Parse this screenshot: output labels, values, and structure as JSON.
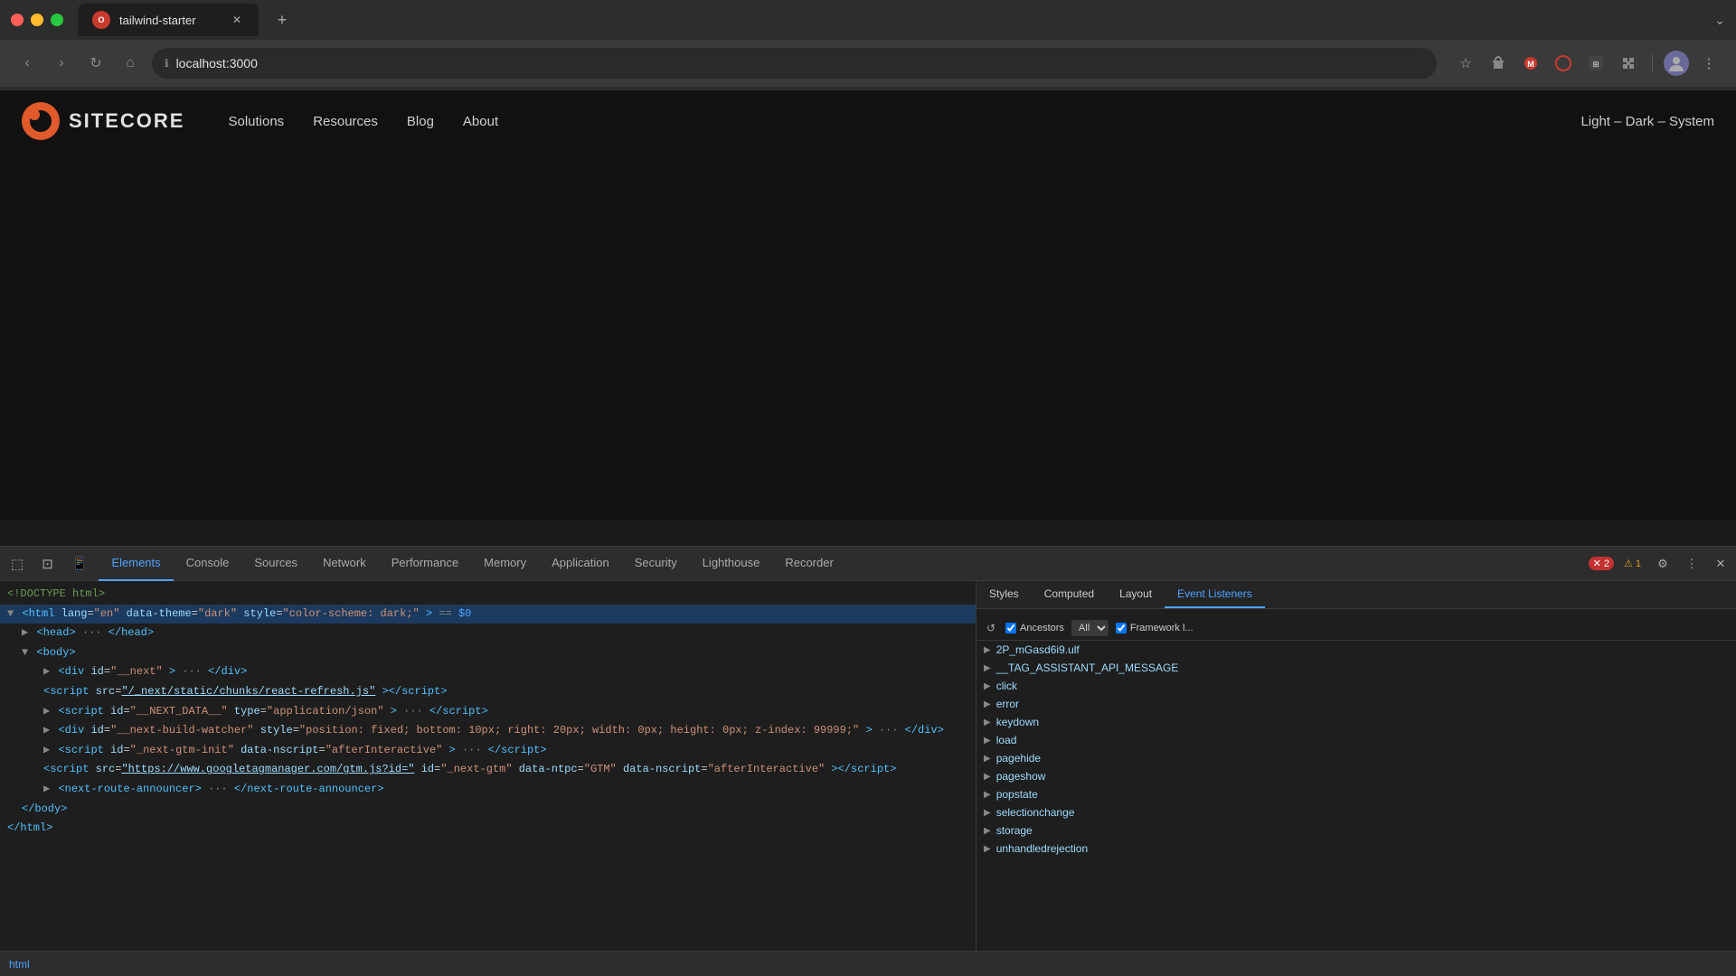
{
  "browser": {
    "tab_title": "tailwind-starter",
    "url": "localhost:3000",
    "new_tab_label": "+",
    "dropdown_label": "⌄"
  },
  "nav_buttons": {
    "back": "‹",
    "forward": "›",
    "reload": "↻",
    "home": "⌂"
  },
  "site": {
    "logo_text": "SITECORE",
    "nav_items": [
      "Solutions",
      "Resources",
      "Blog",
      "About"
    ],
    "theme_text": "Light – Dark – System"
  },
  "devtools": {
    "tabs": [
      {
        "label": "Elements",
        "active": true
      },
      {
        "label": "Console",
        "active": false
      },
      {
        "label": "Sources",
        "active": false
      },
      {
        "label": "Network",
        "active": false
      },
      {
        "label": "Performance",
        "active": false
      },
      {
        "label": "Memory",
        "active": false
      },
      {
        "label": "Application",
        "active": false
      },
      {
        "label": "Security",
        "active": false
      },
      {
        "label": "Lighthouse",
        "active": false
      },
      {
        "label": "Recorder",
        "active": false
      }
    ],
    "error_count": "2",
    "warn_count": "1",
    "dom": {
      "line1": "<!DOCTYPE html>",
      "line2_open": "<html",
      "line2_attr1": "lang",
      "line2_val1": "\"en\"",
      "line2_attr2": "data-theme",
      "line2_val2": "\"dark\"",
      "line2_attr3": "style",
      "line2_val3": "\"color-scheme: dark;\"",
      "line2_special": "== $0",
      "line3": "<head>",
      "line3_collapse": "···",
      "line4": "</head>",
      "line5": "<body>",
      "line6_indent": "<div",
      "line6_attr": "id",
      "line6_val": "\"__next\"",
      "line6_collapse": "···",
      "line6_close": "</div>",
      "line7_src": "\"/_next/static/chunks/react-refresh.js\"",
      "line8_id": "\"__NEXT_DATA__\"",
      "line8_type": "\"application/json\"",
      "line8_collapse": "···",
      "line9_id": "\"__next-build-watcher\"",
      "line9_style": "\"position: fixed; bottom: 10px; right: 20px; width: 0px; height: 0px; z-index: 99999;\"",
      "line9_collapse": "···",
      "line10_id": "\"_next-gtm-init\"",
      "line10_attr": "data-nscript",
      "line10_val": "\"afterInteractive\"",
      "line10_collapse": "···",
      "line11_src": "\"https://www.googletagmanager.com/gtm.js?id=\"",
      "line11_id": "\"_next-gtm\"",
      "line11_attr1": "data-ntpc",
      "line11_val1": "\"GTM\"",
      "line11_attr2": "data-nscript",
      "line11_val2": "\"afterInteractive\"",
      "line12_id": "\"next-route-announcer\"",
      "line12_collapse": "···",
      "line12_close": "</next-route-announcer>",
      "line13": "</body>",
      "line14": "</html>"
    },
    "styles_tabs": [
      "Styles",
      "Computed",
      "Layout",
      "Event Listeners"
    ],
    "active_styles_tab": "Event Listeners",
    "event_listeners": {
      "toolbar": {
        "ancestors_label": "Ancestors",
        "all_label": "All",
        "framework_label": "Framework l..."
      },
      "items": [
        "2P_mGasd6i9.ulf",
        "__TAG_ASSISTANT_API_MESSAGE",
        "click",
        "error",
        "keydown",
        "load",
        "pagehide",
        "pageshow",
        "popstate",
        "selectionchange",
        "storage",
        "unhandledrejection"
      ]
    },
    "breadcrumb": "html"
  }
}
